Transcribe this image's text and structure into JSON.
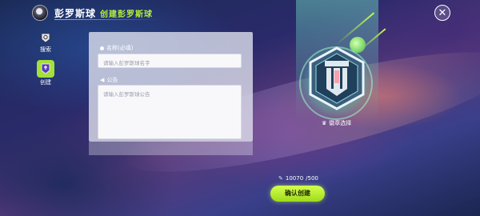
{
  "header": {
    "title": "彭罗斯球",
    "subtitle": "创建彭罗斯球",
    "close_icon": "close-icon"
  },
  "sidebar": {
    "items": [
      {
        "label": "搜索",
        "icon": "search-icon"
      },
      {
        "label": "创建",
        "icon": "create-icon",
        "active": true
      }
    ]
  },
  "form": {
    "name_label": "名称(必填)",
    "name_placeholder": "请输入彭罗斯球名字",
    "notice_label": "公告",
    "notice_placeholder": "请输入彭罗斯球公告"
  },
  "emblem": {
    "caption": "徽章选择",
    "caption_icon": "crown-icon"
  },
  "footer": {
    "cost": "10070",
    "cost_required": "/500",
    "confirm_label": "确认创建"
  },
  "colors": {
    "accent": "#b4ee3a",
    "button": "#c4f23a"
  }
}
